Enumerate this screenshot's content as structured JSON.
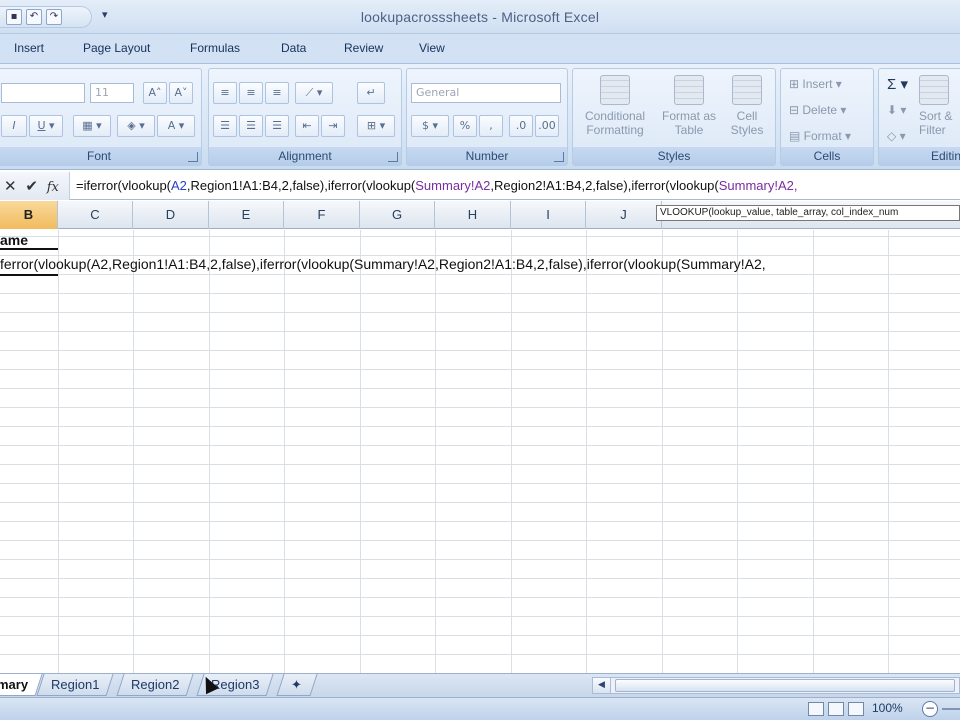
{
  "window": {
    "title": "lookupacrosssheets - Microsoft Excel"
  },
  "ribbon_tabs": [
    "Insert",
    "Page Layout",
    "Formulas",
    "Data",
    "Review",
    "View"
  ],
  "ribbon": {
    "font": {
      "size_value": "11",
      "group_label": "Font"
    },
    "alignment": {
      "group_label": "Alignment"
    },
    "number": {
      "format_value": "General",
      "group_label": "Number"
    },
    "styles": {
      "conditional_formatting": "Conditional Formatting",
      "format_as_table": "Format as Table",
      "cell_styles": "Cell Styles",
      "group_label": "Styles"
    },
    "cells": {
      "insert": "Insert",
      "delete": "Delete",
      "format": "Format",
      "group_label": "Cells"
    },
    "editing": {
      "sort_filter": "Sort & Filter",
      "group_label": "Editin"
    }
  },
  "formula_bar": {
    "prefix": "=iferror(vlookup(",
    "r1": "A2",
    "mid1": ",Region1!A1:B4,2,false),iferror(vlookup(",
    "r2": "Summary!A2",
    "mid2": ",Region2!A1:B4,2,false),iferror(vlookup(",
    "r3": "Summary!A2,"
  },
  "columns": [
    "B",
    "C",
    "D",
    "E",
    "F",
    "G",
    "H",
    "I",
    "J"
  ],
  "selected_column": "B",
  "tooltip": "VLOOKUP(lookup_value, table_array, col_index_num",
  "cells": {
    "b1": "ame",
    "b2": "ferror(vlookup(A2,Region1!A1:B4,2,false),iferror(vlookup(Summary!A2,Region2!A1:B4,2,false),iferror(vlookup(Summary!A2,"
  },
  "sheet_tabs": [
    "mary",
    "Region1",
    "Region2",
    "Region3"
  ],
  "active_sheet": "mary",
  "status": {
    "zoom": "100%"
  },
  "colors": {
    "selected_header": "#f1bb5d",
    "ribbon_bg": "#d6e4f5",
    "function_ref": "#2a3fc7",
    "summary_ref": "#7a2ca0"
  }
}
